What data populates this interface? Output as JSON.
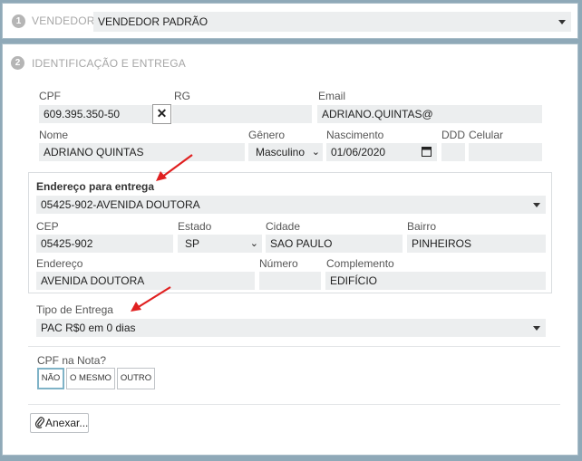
{
  "vendedor": {
    "step": "1",
    "label": "VENDEDOR",
    "selected": "VENDEDOR PADRÃO"
  },
  "ident": {
    "step": "2",
    "title": "IDENTIFICAÇÃO E ENTREGA"
  },
  "labels": {
    "cpf": "CPF",
    "rg": "RG",
    "email": "Email",
    "nome": "Nome",
    "genero": "Gênero",
    "nascimento": "Nascimento",
    "ddd": "DDD",
    "celular": "Celular"
  },
  "values": {
    "cpf": "609.395.350-50",
    "rg": "",
    "email": "ADRIANO.QUINTAS@",
    "nome": "ADRIANO QUINTAS",
    "genero": "Masculino",
    "nascimento": "01/06/2020",
    "ddd": "",
    "celular": ""
  },
  "endereco": {
    "heading": "Endereço para entrega",
    "selected": "05425-902-AVENIDA DOUTORA",
    "labels": {
      "cep": "CEP",
      "estado": "Estado",
      "cidade": "Cidade",
      "bairro": "Bairro",
      "endereco": "Endereço",
      "numero": "Número",
      "complemento": "Complemento"
    },
    "values": {
      "cep": "05425-902",
      "estado": "SP",
      "cidade": "SAO PAULO",
      "bairro": "PINHEIROS",
      "endereco": "AVENIDA DOUTORA",
      "numero": "",
      "complemento": "EDIFÍCIO"
    }
  },
  "entrega": {
    "label": "Tipo de Entrega",
    "selected": "PAC R$0 em 0 dias"
  },
  "cpf_nota": {
    "label": "CPF na Nota?",
    "options": [
      "NÃO",
      "O MESMO",
      "OUTRO"
    ],
    "active": "NÃO"
  },
  "anexar": {
    "label": "Anexar..."
  },
  "colors": {
    "annotation_arrow": "#e02020",
    "field_bg": "#eceeef",
    "active_border": "#7fb3c7"
  }
}
